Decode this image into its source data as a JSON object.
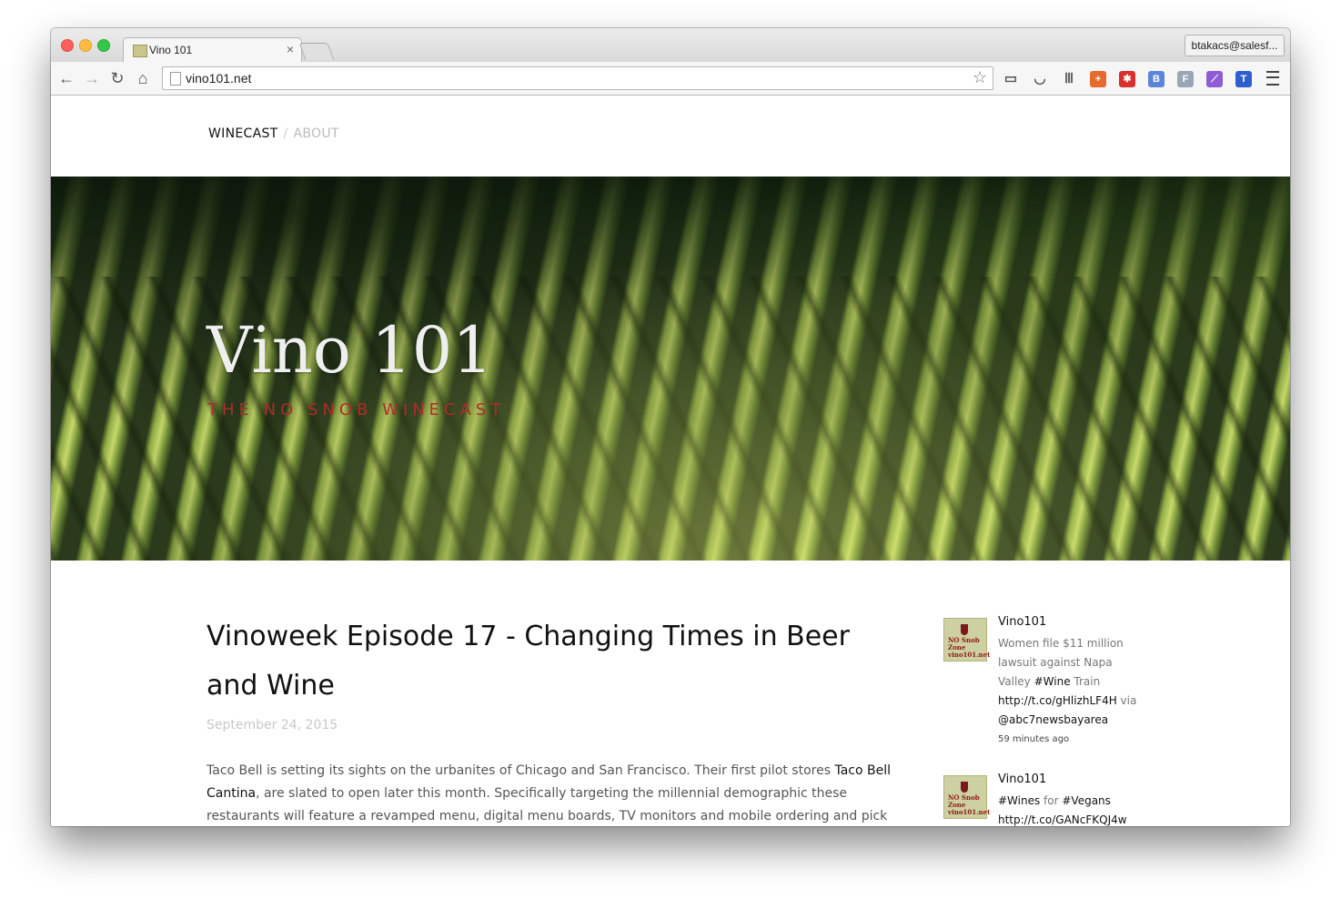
{
  "browser": {
    "tab_title": "Vino 101",
    "tab_close": "×",
    "profile_label": "btakacs@salesf...",
    "url": "vino101.net",
    "nav_icons": {
      "back": "←",
      "forward": "→",
      "reload": "↻",
      "home": "⌂",
      "star": "☆"
    },
    "extensions": [
      {
        "name": "ruler-icon",
        "glyph": "▭",
        "color": "#555555"
      },
      {
        "name": "pocket-icon",
        "glyph": "◡",
        "color": "#555555"
      },
      {
        "name": "instapaper-icon",
        "glyph": "Ⅲ",
        "color": "#666666"
      },
      {
        "name": "plus-extension-icon",
        "glyph": "+",
        "color": "#e46a2d"
      },
      {
        "name": "asterisk-extension-icon",
        "glyph": "✱",
        "color": "#d9302b"
      },
      {
        "name": "b-extension-icon",
        "glyph": "B",
        "color": "#5b86d8"
      },
      {
        "name": "f-extension-icon",
        "glyph": "F",
        "color": "#9aa5b5"
      },
      {
        "name": "feather-icon",
        "glyph": "⟋",
        "color": "#8f5bd6"
      },
      {
        "name": "t-extension-icon",
        "glyph": "T",
        "color": "#2e5fd0"
      }
    ]
  },
  "site": {
    "nav": {
      "winecast": "WINECAST",
      "separator": "/",
      "about": "ABOUT"
    },
    "hero": {
      "title": "Vino 101",
      "tagline": "THE NO SNOB WINECAST"
    },
    "post": {
      "title": "Vinoweek Episode 17 - Changing Times in Beer and Wine",
      "date": "September 24, 2015",
      "body_part1": "Taco Bell is setting its sights on the urbanites of Chicago and San Francisco. Their first pilot stores ",
      "body_link": "Taco Bell Cantina",
      "body_part2": ", are slated to open later this month.  Specifically targeting the millennial demographic these restaurants will feature a revamped menu, digital menu boards, TV monitors and mobile ordering and pick up apps.  The"
    },
    "tweets": [
      {
        "user": "Vino101",
        "avatar_text": "NO Snob Zone vino101.net",
        "t1": "Women file $11 million lawsuit against Napa Valley ",
        "h1": "#Wine",
        "t2": " Train ",
        "h2": "http://t.co/gHlizhLF4H",
        "t3": " via ",
        "h3": "@abc7newsbayarea",
        "time": "59 minutes ago"
      },
      {
        "user": "Vino101",
        "avatar_text": "NO Snob Zone vino101.net",
        "h1": "#Wines",
        "t1": " for ",
        "h2": "#Vegans",
        "h3": "http://t.co/GANcFKQJ4w"
      }
    ]
  }
}
